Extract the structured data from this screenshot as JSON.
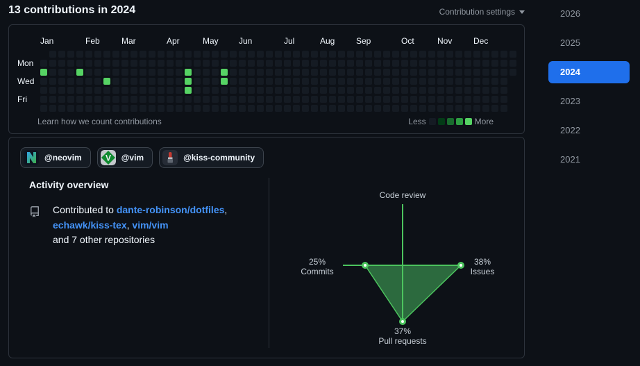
{
  "colors": {
    "background": "#0d1117",
    "accent_blue": "#1f6feb",
    "link_blue": "#4493f8",
    "cell_empty": "#151b23",
    "cell_active": "#56d364",
    "radar_line": "#4cc45e",
    "radar_fill": "#2c6a3e"
  },
  "header": {
    "title": "13 contributions in 2024",
    "settings_label": "Contribution settings"
  },
  "graph": {
    "months": [
      {
        "label": "Jan",
        "col": 0
      },
      {
        "label": "Feb",
        "col": 5
      },
      {
        "label": "Mar",
        "col": 9
      },
      {
        "label": "Apr",
        "col": 14
      },
      {
        "label": "May",
        "col": 18
      },
      {
        "label": "Jun",
        "col": 22
      },
      {
        "label": "Jul",
        "col": 27
      },
      {
        "label": "Aug",
        "col": 31
      },
      {
        "label": "Sep",
        "col": 35
      },
      {
        "label": "Oct",
        "col": 40
      },
      {
        "label": "Nov",
        "col": 44
      },
      {
        "label": "Dec",
        "col": 48
      }
    ],
    "day_labels": [
      {
        "label": "Mon",
        "row": 1
      },
      {
        "label": "Wed",
        "row": 3
      },
      {
        "label": "Fri",
        "row": 5
      }
    ],
    "weeks": 53,
    "first_week_skip_days": 1,
    "last_week_keep_days": 3,
    "active_cells": [
      [
        0,
        2
      ],
      [
        4,
        2
      ],
      [
        7,
        3
      ],
      [
        16,
        2
      ],
      [
        16,
        3
      ],
      [
        16,
        4
      ],
      [
        20,
        2
      ],
      [
        20,
        3
      ]
    ],
    "footer_link": "Learn how we count contributions",
    "legend": {
      "less": "Less",
      "more": "More",
      "colors": [
        "#151b23",
        "#033a16",
        "#196c2e",
        "#2ea043",
        "#56d364"
      ]
    }
  },
  "orgs": [
    {
      "handle": "@neovim",
      "icon": "neovim-logo"
    },
    {
      "handle": "@vim",
      "icon": "vim-logo"
    },
    {
      "handle": "@kiss-community",
      "icon": "kiss-community-logo"
    }
  ],
  "activity": {
    "heading": "Activity overview",
    "intro": "Contributed to",
    "repos": [
      "dante-robinson/dotfiles",
      "echawk/kiss-tex",
      "vim/vim"
    ],
    "comma": ",",
    "suffix": "and 7 other repositories"
  },
  "radar": {
    "top": {
      "percent": "",
      "label": "Code review"
    },
    "left": {
      "percent": "25%",
      "label": "Commits"
    },
    "right": {
      "percent": "38%",
      "label": "Issues"
    },
    "bottom": {
      "percent": "37%",
      "label": "Pull requests"
    }
  },
  "years": {
    "items": [
      "2026",
      "2025",
      "2024",
      "2023",
      "2022",
      "2021"
    ],
    "selected": "2024"
  }
}
